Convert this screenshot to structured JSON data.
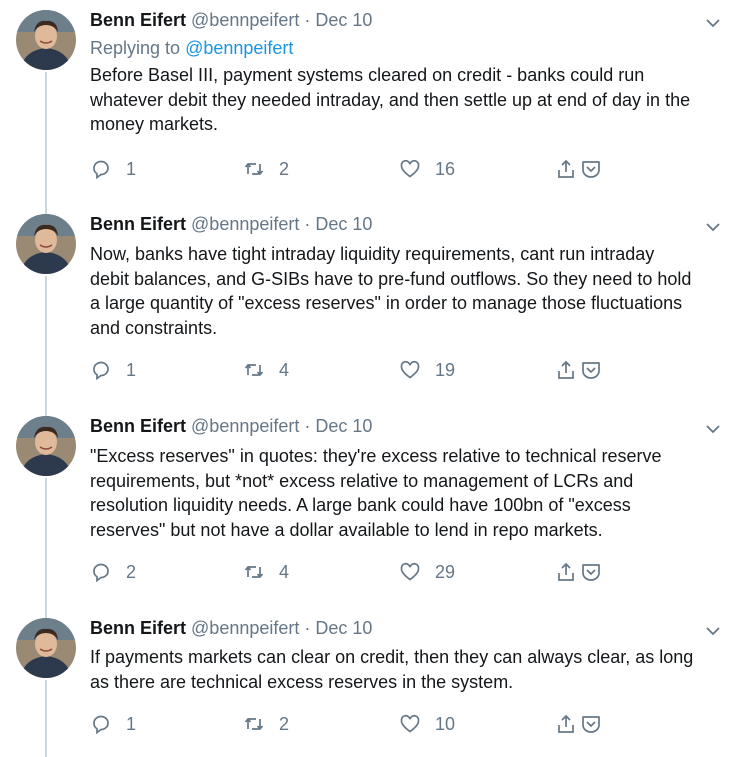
{
  "thread": [
    {
      "name": "Benn Eifert",
      "handle": "@bennpeifert",
      "separator": "·",
      "date": "Dec 10",
      "replying_prefix": "Replying to",
      "replying_handle": "@bennpeifert",
      "lines": [
        "Before Basel III, payment systems cleared on credit - banks could run",
        "whatever debit they needed intraday, and then settle up at end of day in the",
        "money markets."
      ],
      "replies": "1",
      "retweets": "2",
      "likes": "16"
    },
    {
      "name": "Benn Eifert",
      "handle": "@bennpeifert",
      "separator": "·",
      "date": "Dec 10",
      "lines": [
        "Now, banks have tight intraday liquidity requirements, cant run intraday",
        "debit balances, and G-SIBs have to pre-fund outflows. So they need to hold",
        "a large quantity of \"excess reserves\" in order to manage those fluctuations",
        "and constraints."
      ],
      "replies": "1",
      "retweets": "4",
      "likes": "19"
    },
    {
      "name": "Benn Eifert",
      "handle": "@bennpeifert",
      "separator": "·",
      "date": "Dec 10",
      "lines": [
        "\"Excess reserves\" in quotes: they're excess relative to technical reserve",
        "requirements, but *not* excess relative to management of LCRs and",
        "resolution liquidity needs. A large bank could have 100bn of \"excess",
        "reserves\" but not have a  dollar available to lend in repo markets."
      ],
      "replies": "2",
      "retweets": "4",
      "likes": "29"
    },
    {
      "name": "Benn Eifert",
      "handle": "@bennpeifert",
      "separator": "·",
      "date": "Dec 10",
      "lines": [
        "If payments markets can clear on credit, then they can always clear, as long",
        "as there are technical excess reserves in the system."
      ],
      "replies": "1",
      "retweets": "2",
      "likes": "10"
    }
  ],
  "icons": {
    "caret": "chevron-down-icon",
    "reply": "reply-icon",
    "retweet": "retweet-icon",
    "like": "heart-icon",
    "share": "share-icon",
    "dm": "dm-icon"
  },
  "colors": {
    "text": "#14171a",
    "muted": "#657786",
    "link": "#1b95e0",
    "thread_line": "#ccd6dd"
  }
}
